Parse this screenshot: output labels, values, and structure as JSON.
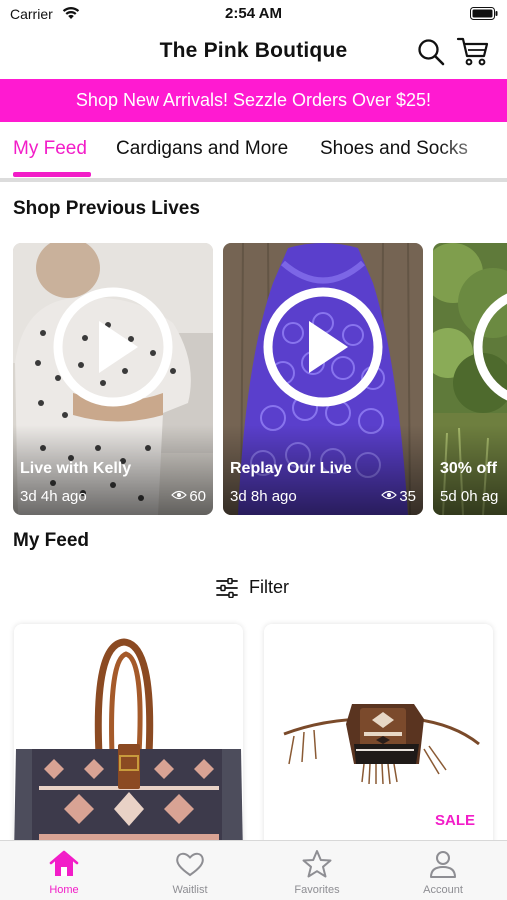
{
  "status_bar": {
    "carrier": "Carrier",
    "time": "2:54 AM"
  },
  "header": {
    "title": "The Pink Boutique"
  },
  "banner": {
    "text": "Shop New Arrivals! Sezzle Orders Over $25!"
  },
  "tabs": [
    {
      "label": "My Feed",
      "active": true
    },
    {
      "label": "Cardigans and More",
      "active": false
    },
    {
      "label": "Shoes and Socks",
      "active": false
    }
  ],
  "lives_section": {
    "title": "Shop Previous Lives",
    "items": [
      {
        "title": "Live with Kelly",
        "time": "3d 4h ago",
        "views": "60"
      },
      {
        "title": "Replay Our Live",
        "time": "3d 8h ago",
        "views": "35"
      },
      {
        "title": "30% off",
        "time": "5d 0h ag",
        "views": ""
      }
    ]
  },
  "feed_section": {
    "title": "My Feed",
    "filter_label": "Filter",
    "products": [
      {
        "name": "aztec-print-tote-bag",
        "badge": ""
      },
      {
        "name": "aztec-fringe-crossbody-bag",
        "badge": "SALE"
      }
    ]
  },
  "tab_bar": {
    "items": [
      {
        "label": "Home",
        "icon": "home-icon",
        "active": true
      },
      {
        "label": "Waitlist",
        "icon": "heart-icon",
        "active": false
      },
      {
        "label": "Favorites",
        "icon": "star-icon",
        "active": false
      },
      {
        "label": "Account",
        "icon": "person-icon",
        "active": false
      }
    ]
  },
  "colors": {
    "accent": "#f21dc8",
    "banner": "#ff1ad1",
    "tab_inactive": "#8e8e93"
  }
}
